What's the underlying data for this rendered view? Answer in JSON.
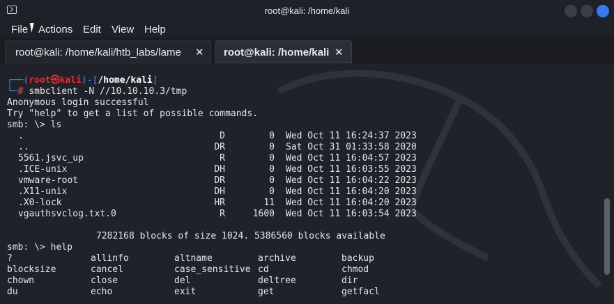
{
  "window": {
    "title": "root@kali: /home/kali"
  },
  "menu": [
    "File",
    "Actions",
    "Edit",
    "View",
    "Help"
  ],
  "tabs": [
    {
      "label": "root@kali: /home/kali/htb_labs/lame",
      "close": "✕"
    },
    {
      "label": "root@kali: /home/kali",
      "close": "✕"
    }
  ],
  "prompt": {
    "line1_open": "┌──(",
    "user": "root",
    "at": "㉿",
    "host": "kali",
    "mid": ")-[",
    "path": "/home/kali",
    "close": "]",
    "line2_prefix": "└─",
    "hash": "#",
    "command": "smbclient -N //10.10.10.3/tmp"
  },
  "output": {
    "l1": "Anonymous login successful",
    "l2": "Try \"help\" to get a list of possible commands.",
    "l3": "smb: \\> ls"
  },
  "listing": [
    {
      "name": ".",
      "attr": "D",
      "size": "0",
      "date": "Wed Oct 11 16:24:37 2023"
    },
    {
      "name": "..",
      "attr": "DR",
      "size": "0",
      "date": "Sat Oct 31 01:33:58 2020"
    },
    {
      "name": "5561.jsvc_up",
      "attr": "R",
      "size": "0",
      "date": "Wed Oct 11 16:04:57 2023"
    },
    {
      "name": ".ICE-unix",
      "attr": "DH",
      "size": "0",
      "date": "Wed Oct 11 16:03:55 2023"
    },
    {
      "name": "vmware-root",
      "attr": "DR",
      "size": "0",
      "date": "Wed Oct 11 16:04:22 2023"
    },
    {
      "name": ".X11-unix",
      "attr": "DH",
      "size": "0",
      "date": "Wed Oct 11 16:04:20 2023"
    },
    {
      "name": ".X0-lock",
      "attr": "HR",
      "size": "11",
      "date": "Wed Oct 11 16:04:20 2023"
    },
    {
      "name": "vgauthsvclog.txt.0",
      "attr": "R",
      "size": "1600",
      "date": "Wed Oct 11 16:03:54 2023"
    }
  ],
  "blocks_line": "7282168 blocks of size 1024. 5386560 blocks available",
  "help_prompt": "smb: \\> help",
  "help_rows": [
    [
      "?",
      "allinfo",
      "altname",
      "archive",
      "backup"
    ],
    [
      "blocksize",
      "cancel",
      "case_sensitive",
      "cd",
      "chmod"
    ],
    [
      "chown",
      "close",
      "del",
      "deltree",
      "dir"
    ],
    [
      "du",
      "echo",
      "exit",
      "get",
      "getfacl"
    ]
  ],
  "colors": {
    "prompt_blue": "#3a8bf5",
    "prompt_red": "#ef2b2b",
    "close_button": "#367bf0"
  }
}
